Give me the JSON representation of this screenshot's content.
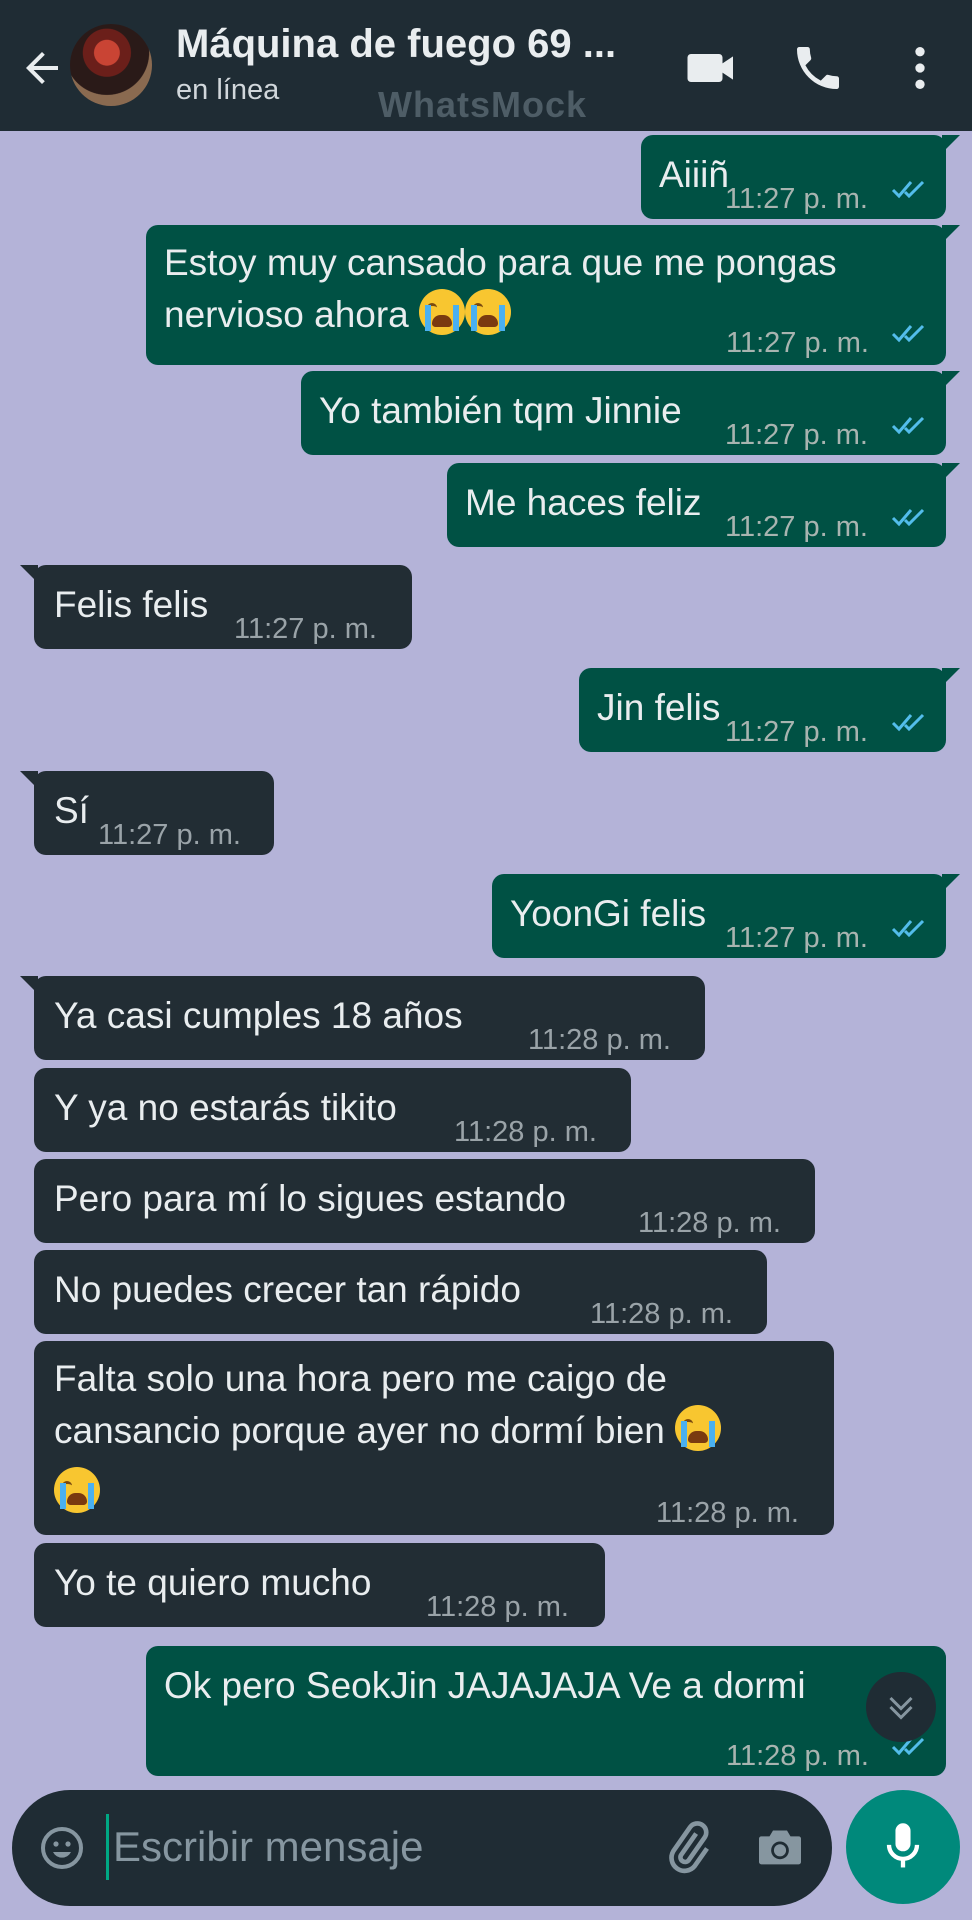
{
  "header": {
    "back_icon": "arrow-left-icon",
    "contact_name": "Máquina de fuego 69 ...",
    "status": "en línea",
    "watermark": "WhatsMock",
    "video_icon": "video-camera-icon",
    "call_icon": "phone-icon",
    "menu_icon": "more-vertical-icon"
  },
  "messages": [
    {
      "dir": "out",
      "text": "Aiiiñ",
      "time": "11:27 p. m.",
      "status": "read"
    },
    {
      "dir": "out",
      "line1": "Estoy muy cansado para que me pongas",
      "line2": "nervioso ahora",
      "emoji": "loudly-crying-face",
      "time": "11:27 p. m.",
      "status": "read"
    },
    {
      "dir": "out",
      "text": "Yo también tqm Jinnie",
      "time": "11:27 p. m.",
      "status": "read"
    },
    {
      "dir": "out",
      "text": "Me haces feliz",
      "time": "11:27 p. m.",
      "status": "read"
    },
    {
      "dir": "in",
      "text": "Felis felis",
      "time": "11:27 p. m."
    },
    {
      "dir": "out",
      "text": "Jin felis",
      "time": "11:27 p. m.",
      "status": "read"
    },
    {
      "dir": "in",
      "text": "Sí",
      "time": "11:27 p. m."
    },
    {
      "dir": "out",
      "text": "YoonGi felis",
      "time": "11:27 p. m.",
      "status": "read"
    },
    {
      "dir": "in",
      "text": "Ya casi cumples 18 años",
      "time": "11:28 p. m."
    },
    {
      "dir": "in",
      "text": "Y ya no estarás tikito",
      "time": "11:28 p. m."
    },
    {
      "dir": "in",
      "text": "Pero para mí lo sigues estando",
      "time": "11:28 p. m."
    },
    {
      "dir": "in",
      "text": "No puedes crecer tan rápido",
      "time": "11:28 p. m."
    },
    {
      "dir": "in",
      "line1": "Falta solo una hora pero me caigo de",
      "line2": "cansancio porque ayer no dormí bien",
      "emoji": "loudly-crying-face",
      "time": "11:28 p. m."
    },
    {
      "dir": "in",
      "text": "Yo te quiero mucho",
      "time": "11:28 p. m."
    },
    {
      "dir": "out",
      "text": "Ok pero SeokJin JAJAJAJA Ve a dormi",
      "time": "11:28 p. m.",
      "status": "read"
    }
  ],
  "scroll_down_icon": "double-chevron-down-icon",
  "composer": {
    "placeholder": "Escribir mensaje",
    "emoji_icon": "smiley-icon",
    "attach_icon": "paperclip-icon",
    "camera_icon": "camera-icon",
    "mic_icon": "microphone-icon"
  },
  "colors": {
    "header": "#1f2c34",
    "chat_background": "#b4b3d8",
    "outgoing_bubble": "#005144",
    "incoming_bubble": "#222d34",
    "read_ticks": "#53bdeb",
    "mic_button": "#00897b"
  }
}
